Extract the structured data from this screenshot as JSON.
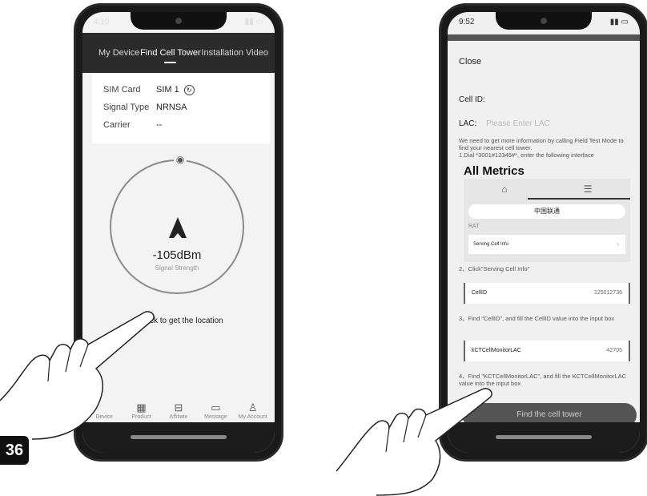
{
  "page_number": "36",
  "left_phone": {
    "status_time": "4:10",
    "tabs": [
      "My Device",
      "Find Cell Tower",
      "Installation Video"
    ],
    "active_tab": "Find Cell Tower",
    "sim": {
      "rows": [
        {
          "label": "SIM Card",
          "value": "SIM 1"
        },
        {
          "label": "Signal Type",
          "value": "NRNSA"
        },
        {
          "label": "Carrier",
          "value": "--"
        }
      ]
    },
    "signal_value": "-105dBm",
    "signal_label": "Signal Strength",
    "location_prompt": "Click to get the location",
    "nav": [
      {
        "label": "Device",
        "icon": "device-icon"
      },
      {
        "label": "Product",
        "icon": "product-grid-icon"
      },
      {
        "label": "Affiliate",
        "icon": "affiliate-icon"
      },
      {
        "label": "Message",
        "icon": "message-icon"
      },
      {
        "label": "My Account",
        "icon": "account-icon"
      }
    ]
  },
  "right_phone": {
    "status_time": "9:52",
    "close_label": "Close",
    "cell_id_label": "Cell ID:",
    "lac_label": "LAC:",
    "lac_placeholder": "Please Enter LAC",
    "info_text": "We need to get more information by calling Field Test Mode to find your nearest cell tower.",
    "step1": "1.Dial *3001#12345#*, enter the following interface",
    "metrics_title": "All Metrics",
    "carrier_name": "中国联通",
    "rat_label": "RAT",
    "serving_cell_label": "Serving Cell Info",
    "step2": "2、Click\"Serving Cell Info\"",
    "cellid_field": {
      "label": "CellID",
      "value": "125012736"
    },
    "step3": "3、Find \"CellID\", and fill the CellID value into the input box",
    "lac_field": {
      "label": "kCTCellMonitorLAC",
      "value": "42705"
    },
    "step4": "4、Find \"KCTCellMonitorLAC\", and fill the KCTCellMonitorLAC value into the input box",
    "find_button": "Find the cell tower"
  }
}
